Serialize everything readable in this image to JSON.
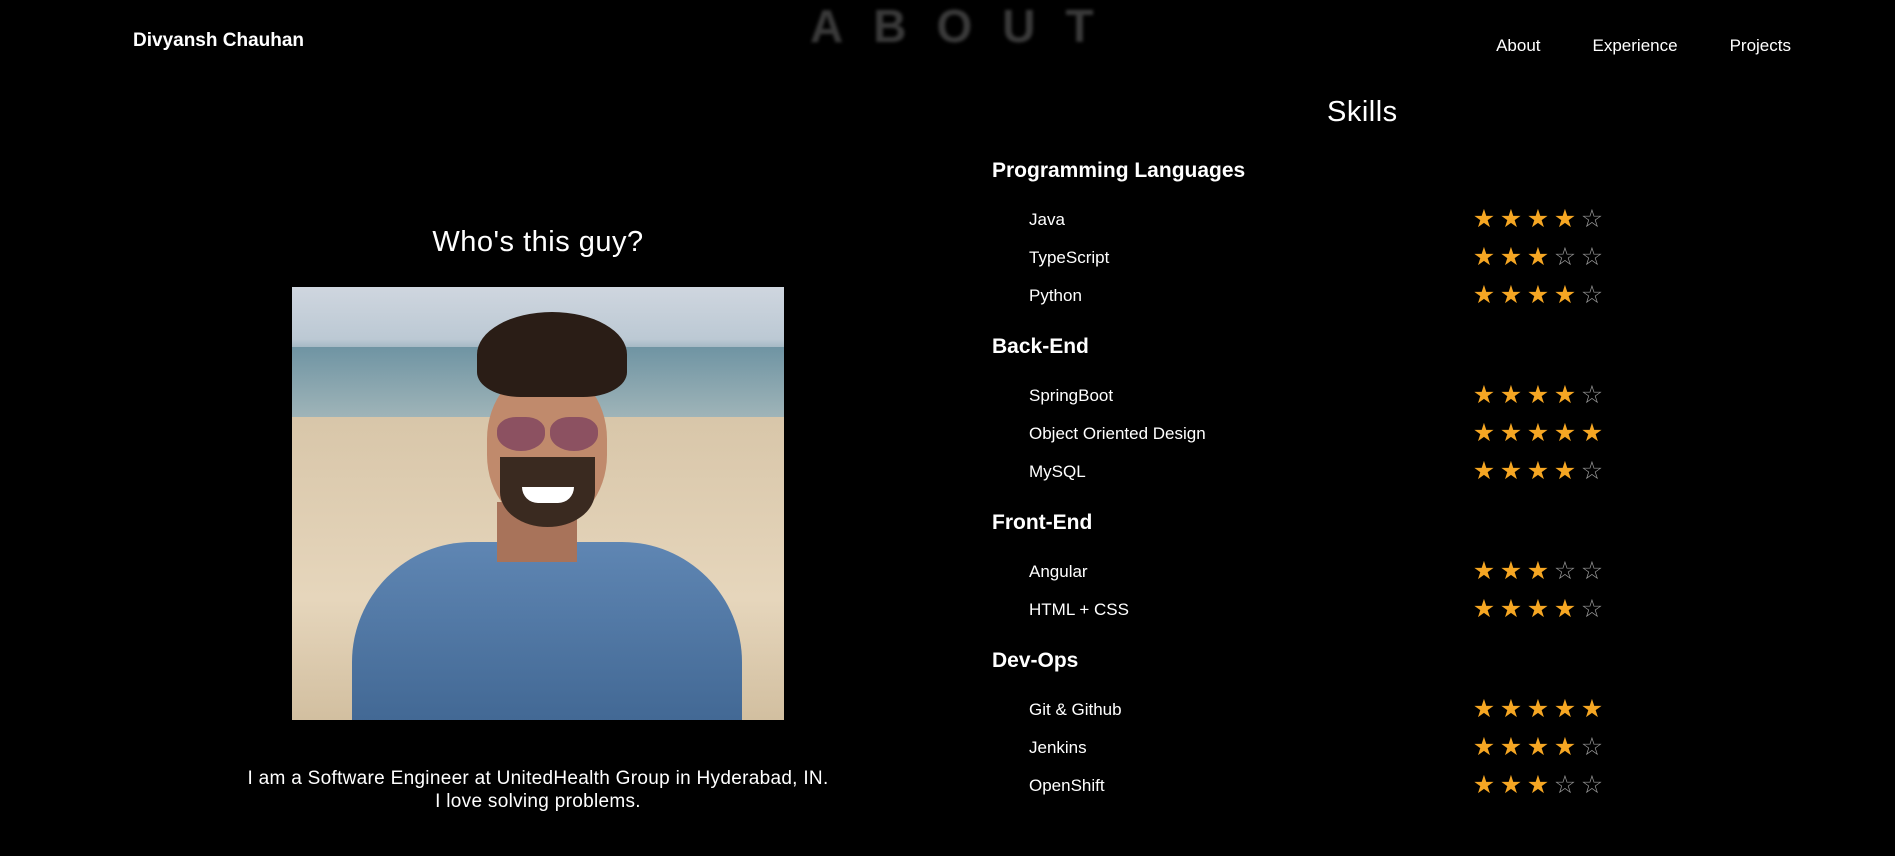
{
  "brand": "Divyansh Chauhan",
  "section_heading": "ABOUT",
  "nav": {
    "items": [
      "About",
      "Experience",
      "Projects"
    ]
  },
  "about": {
    "heading": "Who's this guy?",
    "bio_line1": "I am a Software Engineer at UnitedHealth Group in Hyderabad, IN.",
    "bio_line2": "I love solving problems."
  },
  "skills": {
    "title": "Skills",
    "max_rating": 5,
    "star_color": "#f5a623",
    "groups": [
      {
        "name": "Programming Languages",
        "items": [
          {
            "name": "Java",
            "rating": 4
          },
          {
            "name": "TypeScript",
            "rating": 3
          },
          {
            "name": "Python",
            "rating": 4
          }
        ]
      },
      {
        "name": "Back-End",
        "items": [
          {
            "name": "SpringBoot",
            "rating": 4
          },
          {
            "name": "Object Oriented Design",
            "rating": 5
          },
          {
            "name": "MySQL",
            "rating": 4
          }
        ]
      },
      {
        "name": "Front-End",
        "items": [
          {
            "name": "Angular",
            "rating": 3
          },
          {
            "name": "HTML + CSS",
            "rating": 4
          }
        ]
      },
      {
        "name": "Dev-Ops",
        "items": [
          {
            "name": "Git & Github",
            "rating": 5
          },
          {
            "name": "Jenkins",
            "rating": 4
          },
          {
            "name": "OpenShift",
            "rating": 3
          }
        ]
      }
    ]
  }
}
